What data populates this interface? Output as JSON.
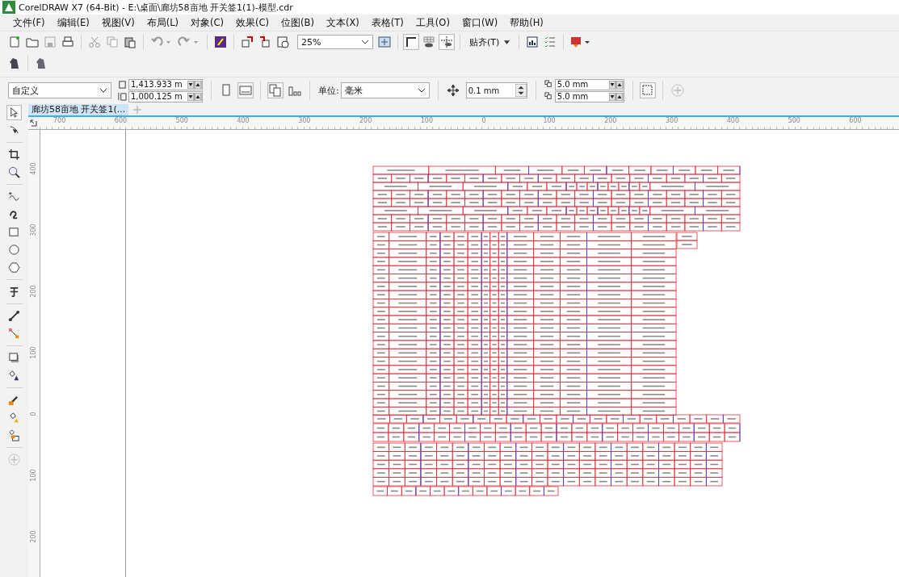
{
  "window": {
    "title": "CorelDRAW X7 (64-Bit) - E:\\桌面\\廊坊58亩地 开关签1(1)-模型.cdr"
  },
  "menu": [
    {
      "label": "文件(F)"
    },
    {
      "label": "编辑(E)"
    },
    {
      "label": "视图(V)"
    },
    {
      "label": "布局(L)"
    },
    {
      "label": "对象(C)"
    },
    {
      "label": "效果(C)"
    },
    {
      "label": "位图(B)"
    },
    {
      "label": "文本(X)"
    },
    {
      "label": "表格(T)"
    },
    {
      "label": "工具(O)"
    },
    {
      "label": "窗口(W)"
    },
    {
      "label": "帮助(H)"
    }
  ],
  "toolbar": {
    "zoom": "25%",
    "snap": "贴齐(T)"
  },
  "property_bar": {
    "page_size": "自定义",
    "width": "1,413.933 m",
    "height": "1,000.125 m",
    "units_label": "单位:",
    "units": "毫米",
    "nudge": "0.1 mm",
    "duplicate_x": "5.0 mm",
    "duplicate_y": "5.0 mm"
  },
  "document_tabs": [
    {
      "label": "廊坊58亩地 开关签1(...",
      "selected": true
    }
  ],
  "rulers": {
    "horizontal": [
      "700",
      "600",
      "500",
      "400",
      "300",
      "200",
      "100",
      "0",
      "100",
      "200",
      "300",
      "400",
      "500",
      "600"
    ],
    "vertical": [
      "400",
      "300",
      "200",
      "100",
      "0",
      "100",
      "200"
    ]
  }
}
